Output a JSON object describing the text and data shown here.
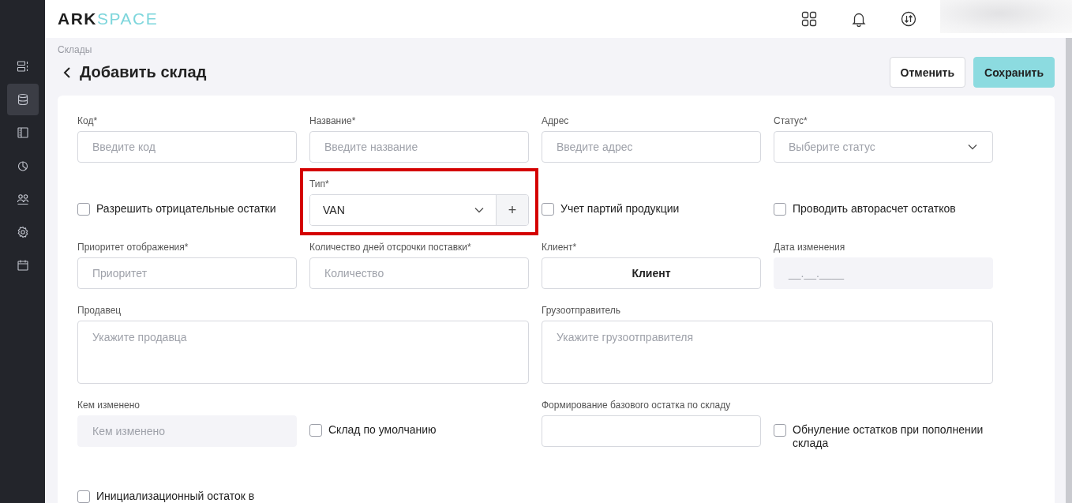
{
  "header": {
    "logo_bold": "ARK",
    "logo_light": "SPACE"
  },
  "sidebar": {
    "items": [
      {
        "selected": false
      },
      {
        "selected": true
      },
      {
        "selected": false
      },
      {
        "selected": false
      },
      {
        "selected": false
      },
      {
        "selected": false
      },
      {
        "selected": false
      }
    ]
  },
  "breadcrumb": "Склады",
  "title": "Добавить склад",
  "buttons": [
    {
      "label": "Отменить",
      "kind": "secondary"
    },
    {
      "label": "Сохранить",
      "kind": "primary"
    }
  ],
  "form": {
    "fields": [
      {
        "kind": "text",
        "label": "Код*",
        "placeholder": "Введите код"
      },
      {
        "kind": "text",
        "label": "Название*",
        "placeholder": "Введите название"
      },
      {
        "kind": "text",
        "label": "Адрес",
        "placeholder": "Введите адрес"
      },
      {
        "kind": "select",
        "label": "Статус*",
        "placeholder": "Выберите статус"
      },
      {
        "kind": "checkbox",
        "label": "Разрешить отрицательные остатки",
        "checked": false
      },
      {
        "kind": "select_add",
        "label": "Тип*",
        "value": "VAN",
        "add": "+",
        "highlighted": true
      },
      {
        "kind": "checkbox",
        "label": "Учет партий продукции",
        "checked": false
      },
      {
        "kind": "checkbox",
        "label": "Проводить авторасчет остатков",
        "checked": false
      },
      {
        "kind": "text",
        "label": "Приоритет отображения*",
        "placeholder": "Приоритет"
      },
      {
        "kind": "text",
        "label": "Количество дней отсрочки поставки*",
        "placeholder": "Количество"
      },
      {
        "kind": "button",
        "label": "Клиент*",
        "value": "Клиент"
      },
      {
        "kind": "disabled",
        "label": "Дата изменения",
        "placeholder": "__.__.____"
      },
      {
        "kind": "textarea",
        "label": "Продавец",
        "placeholder": "Укажите продавца"
      },
      {
        "kind": "textarea",
        "label": "Грузоотправитель",
        "placeholder": "Укажите грузоотправителя"
      },
      {
        "kind": "disabled",
        "label": "Кем изменено",
        "placeholder": "Кем изменено"
      },
      {
        "kind": "checkbox",
        "label": "Склад по умолчанию",
        "checked": false
      },
      {
        "kind": "text",
        "label": "Формирование базового остатка по складу"
      },
      {
        "kind": "checkbox",
        "label": "Обнуление остатков при пополнении склада",
        "checked": false
      },
      {
        "kind": "checkbox",
        "label": "Инициализационный остаток в",
        "checked": false
      }
    ]
  }
}
